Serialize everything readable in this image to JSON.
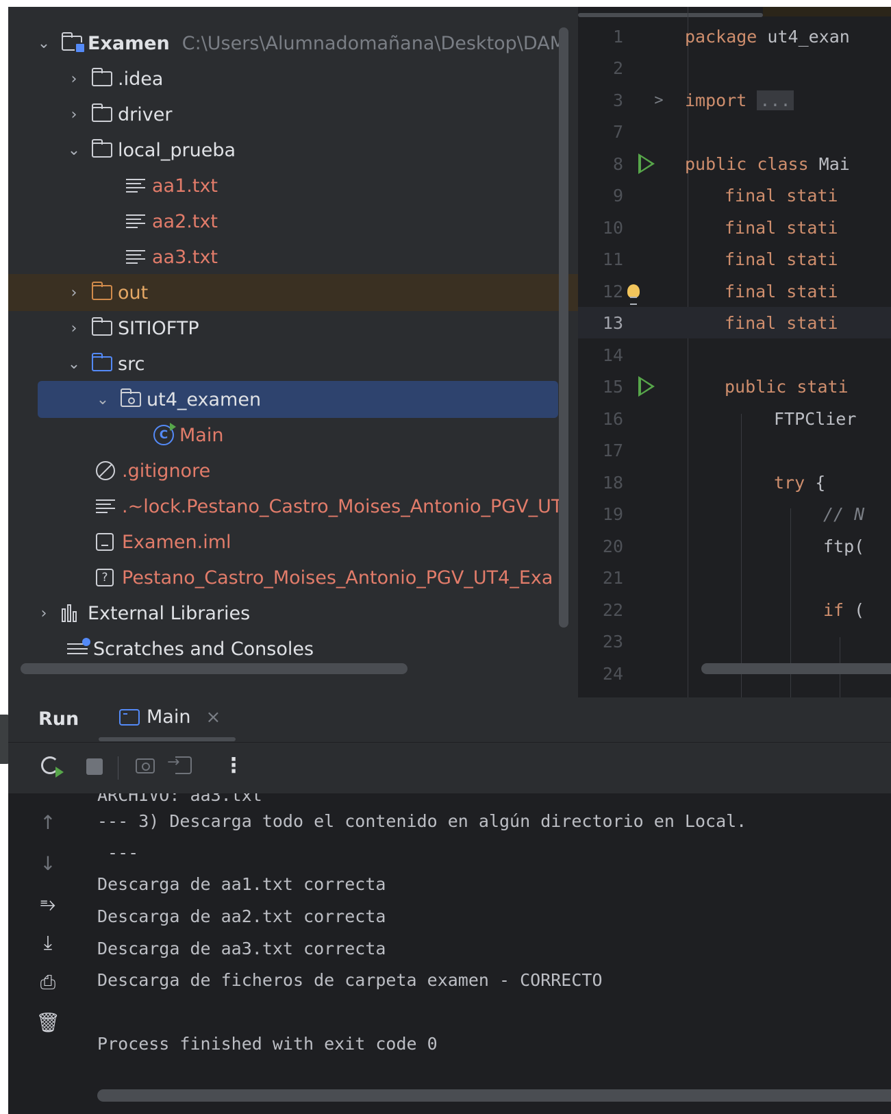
{
  "project_tree": {
    "root": {
      "name": "Examen",
      "path": "C:\\Users\\Alumnadomañana\\Desktop\\DAM"
    },
    "items": [
      {
        "label": ".idea"
      },
      {
        "label": "driver"
      },
      {
        "label": "local_prueba"
      },
      {
        "label": "aa1.txt"
      },
      {
        "label": "aa2.txt"
      },
      {
        "label": "aa3.txt"
      },
      {
        "label": "out"
      },
      {
        "label": "SITIOFTP"
      },
      {
        "label": "src"
      },
      {
        "label": "ut4_examen"
      },
      {
        "label": "Main"
      },
      {
        "label": ".gitignore"
      },
      {
        "label": ".~lock.Pestano_Castro_Moises_Antonio_PGV_UT"
      },
      {
        "label": "Examen.iml"
      },
      {
        "label": "Pestano_Castro_Moises_Antonio_PGV_UT4_Exa"
      },
      {
        "label": "External Libraries"
      },
      {
        "label": "Scratches and Consoles"
      }
    ],
    "icons": {
      "class": "C",
      "unknown": "?"
    }
  },
  "editor": {
    "line_numbers": [
      "1",
      "2",
      "3",
      "7",
      "8",
      "9",
      "10",
      "11",
      "12",
      "13",
      "14",
      "15",
      "16",
      "17",
      "18",
      "19",
      "20",
      "21",
      "22",
      "23",
      "24"
    ],
    "lines": {
      "l1": {
        "kw": "package",
        "rest": " ut4_exan"
      },
      "l3": {
        "kw": "import",
        "ellipsis": "..."
      },
      "l8": {
        "kw": "public class",
        "rest": " Mai"
      },
      "l9": {
        "kw": "final stati"
      },
      "l10": {
        "kw": "final stati"
      },
      "l11": {
        "kw": "final stati"
      },
      "l12": {
        "kw": "final stati"
      },
      "l13": {
        "kw": "final stati"
      },
      "l15": {
        "kw": "public stati"
      },
      "l16": {
        "rest": "FTPClier"
      },
      "l18": {
        "kw": "try",
        "rest": " {"
      },
      "l19": {
        "comment": "// N"
      },
      "l20": {
        "rest": "ftp("
      },
      "l22": {
        "kw": "if",
        "rest": " ("
      }
    },
    "fold_chevron": ">"
  },
  "run_panel": {
    "title": "Run",
    "tab_label": "Main",
    "close_glyph": "×",
    "more_glyph": "⋮",
    "side_icons": {
      "up": "↑",
      "down": "↓",
      "wrap": "⥱",
      "scroll_end": "⤓",
      "print": "⎙",
      "trash": "🗑"
    },
    "console": {
      "cut_line": "ARCHIVO: aa3.txt",
      "lines": [
        "--- 3) Descarga todo el contenido en algún directorio en Local.",
        " ---",
        "Descarga de aa1.txt correcta",
        "Descarga de aa2.txt correcta",
        "Descarga de aa3.txt correcta",
        "Descarga de ficheros de carpeta examen - CORRECTO",
        "",
        "Process finished with exit code 0"
      ]
    }
  }
}
